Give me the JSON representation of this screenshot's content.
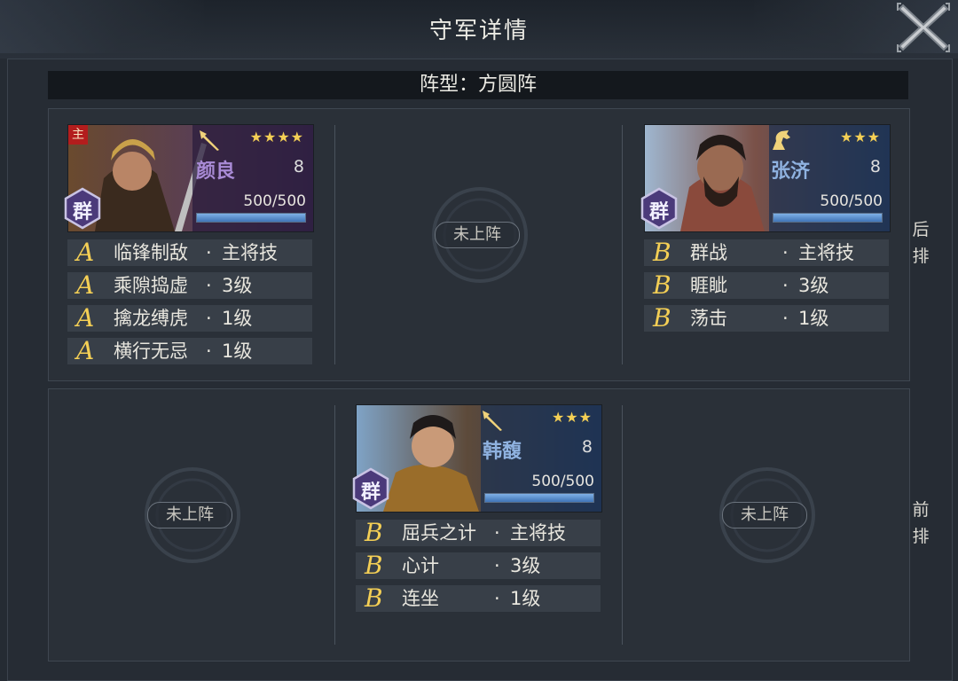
{
  "title": "守军详情",
  "formation": {
    "label": "阵型：方圆阵"
  },
  "row_labels": {
    "back": [
      "后",
      "排"
    ],
    "front": [
      "前",
      "排"
    ]
  },
  "empty_slot_label": "未上阵",
  "generals": [
    {
      "name": "颜良",
      "level": "8",
      "stars": "★★★★",
      "star_count": 4,
      "troops": "500/500",
      "troops_fraction": 1.0,
      "faction": "群",
      "is_main": true,
      "main_label": "主",
      "weapon_icon": "spear-icon",
      "portrait_tone": "purple",
      "skills": [
        {
          "grade": "A",
          "name": "临锋制敌",
          "sep": "·",
          "level": "主将技"
        },
        {
          "grade": "A",
          "name": "乘隙捣虚",
          "sep": "·",
          "level": "3级"
        },
        {
          "grade": "A",
          "name": "擒龙缚虎",
          "sep": "·",
          "level": "1级"
        },
        {
          "grade": "A",
          "name": "横行无忌",
          "sep": "·",
          "level": "1级"
        }
      ]
    },
    {
      "name": "张济",
      "level": "8",
      "stars": "★★★",
      "star_count": 3,
      "troops": "500/500",
      "troops_fraction": 1.0,
      "faction": "群",
      "is_main": false,
      "weapon_icon": "horse-icon",
      "portrait_tone": "blue",
      "skills": [
        {
          "grade": "B",
          "name": "群战",
          "sep": "·",
          "level": "主将技"
        },
        {
          "grade": "B",
          "name": "睚眦",
          "sep": "·",
          "level": "3级"
        },
        {
          "grade": "B",
          "name": "荡击",
          "sep": "·",
          "level": "1级"
        }
      ]
    },
    {
      "name": "韩馥",
      "level": "8",
      "stars": "★★★",
      "star_count": 3,
      "troops": "500/500",
      "troops_fraction": 1.0,
      "faction": "群",
      "is_main": false,
      "weapon_icon": "spear-icon",
      "portrait_tone": "blue",
      "skills": [
        {
          "grade": "B",
          "name": "屈兵之计",
          "sep": "·",
          "level": "主将技"
        },
        {
          "grade": "B",
          "name": "心计",
          "sep": "·",
          "level": "3级"
        },
        {
          "grade": "B",
          "name": "连坐",
          "sep": "·",
          "level": "1级"
        }
      ]
    }
  ],
  "colors": {
    "star": "#f4cf55",
    "grade": "#f4cf55",
    "main_badge": "#b31d1d",
    "troop_bar": "#3f74b7"
  }
}
